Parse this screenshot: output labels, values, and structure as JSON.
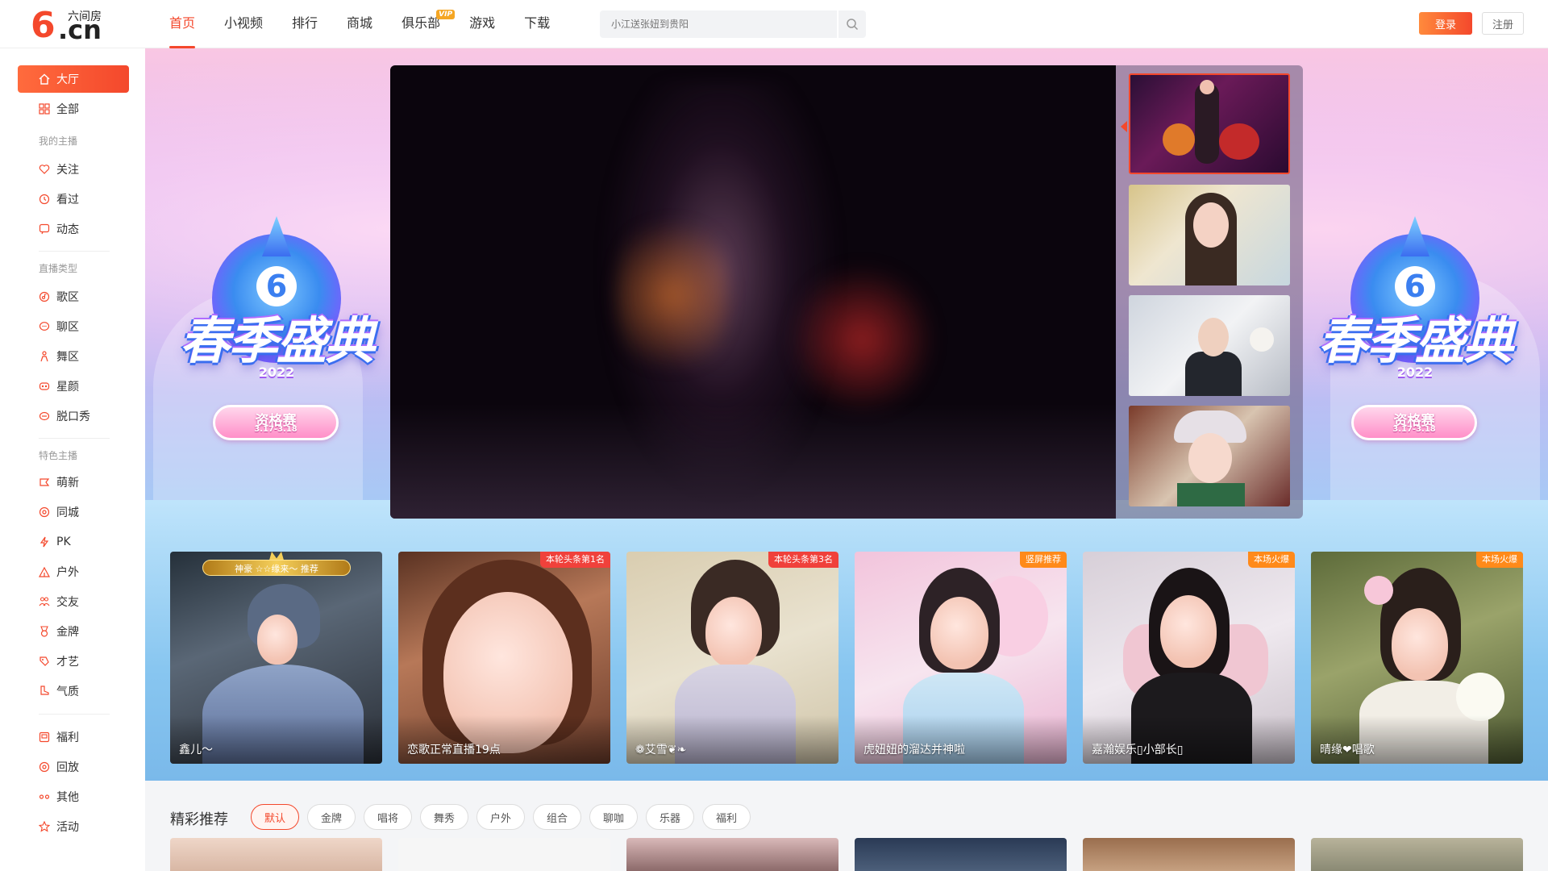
{
  "header": {
    "logo_brand": "六间房",
    "logo_six": "6",
    "logo_cn": ".cn",
    "nav": [
      {
        "label": "首页",
        "active": true
      },
      {
        "label": "小视频"
      },
      {
        "label": "排行"
      },
      {
        "label": "商城"
      },
      {
        "label": "俱乐部",
        "badge": "VIP"
      },
      {
        "label": "游戏"
      },
      {
        "label": "下载"
      }
    ],
    "search_placeholder": "小江送张妞到贵阳",
    "login_label": "登录",
    "register_label": "注册"
  },
  "sidebar": {
    "items": [
      {
        "label": "大厅",
        "icon": "home-icon",
        "active": true
      },
      {
        "label": "全部",
        "icon": "grid-icon"
      }
    ],
    "group_my": "我的主播",
    "my_items": [
      {
        "label": "关注",
        "icon": "heart-icon"
      },
      {
        "label": "看过",
        "icon": "clock-icon"
      },
      {
        "label": "动态",
        "icon": "chat-icon"
      }
    ],
    "group_type": "直播类型",
    "type_items": [
      {
        "label": "歌区",
        "icon": "music-icon"
      },
      {
        "label": "聊区",
        "icon": "bubble-icon"
      },
      {
        "label": "舞区",
        "icon": "dancer-icon"
      },
      {
        "label": "星颜",
        "icon": "mask-icon"
      },
      {
        "label": "脱口秀",
        "icon": "mic-icon"
      }
    ],
    "group_feature": "特色主播",
    "feature_items": [
      {
        "label": "萌新",
        "icon": "sprout-icon"
      },
      {
        "label": "同城",
        "icon": "location-icon"
      },
      {
        "label": "PK",
        "icon": "lightning-icon"
      },
      {
        "label": "户外",
        "icon": "tent-icon"
      },
      {
        "label": "交友",
        "icon": "people-icon"
      },
      {
        "label": "金牌",
        "icon": "medal-icon"
      },
      {
        "label": "才艺",
        "icon": "palette-icon"
      },
      {
        "label": "气质",
        "icon": "shoe-icon"
      }
    ],
    "extra_items": [
      {
        "label": "福利",
        "icon": "gift-icon"
      },
      {
        "label": "回放",
        "icon": "replay-icon"
      },
      {
        "label": "其他",
        "icon": "more-icon"
      },
      {
        "label": "活动",
        "icon": "star-icon"
      }
    ]
  },
  "banner": {
    "title": "春季盛典",
    "year": "2022",
    "pill_title": "资格赛",
    "pill_date": "3.17-3.18"
  },
  "live_cards": [
    {
      "name": "鑫儿～",
      "honor": "神豪 ☆☆缘来～ 推荐"
    },
    {
      "name": "恋歌正常直播19点",
      "tag": "本轮头条第1名",
      "tag_color": "#f0413b"
    },
    {
      "name": "❁艾雪❦❧",
      "tag": "本轮头条第3名",
      "tag_color": "#f0413b"
    },
    {
      "name": "虎妞妞的溜达并神啦",
      "tag": "竖屏推荐",
      "tag_color": "#ff8a1a"
    },
    {
      "name": "嘉瀚娱乐▯小部长▯",
      "tag": "本场火爆",
      "tag_color": "#ff8a1a"
    },
    {
      "name": "晴缘❤唱歌",
      "tag": "本场火爆",
      "tag_color": "#ff8a1a"
    }
  ],
  "recommend": {
    "title": "精彩推荐",
    "chips": [
      {
        "label": "默认",
        "active": true
      },
      {
        "label": "金牌"
      },
      {
        "label": "唱将"
      },
      {
        "label": "舞秀"
      },
      {
        "label": "户外"
      },
      {
        "label": "组合"
      },
      {
        "label": "聊咖"
      },
      {
        "label": "乐器"
      },
      {
        "label": "福利"
      }
    ]
  },
  "colors": {
    "accent": "#f4482c",
    "tag_red": "#f0413b",
    "tag_orange": "#ff8a1a"
  }
}
